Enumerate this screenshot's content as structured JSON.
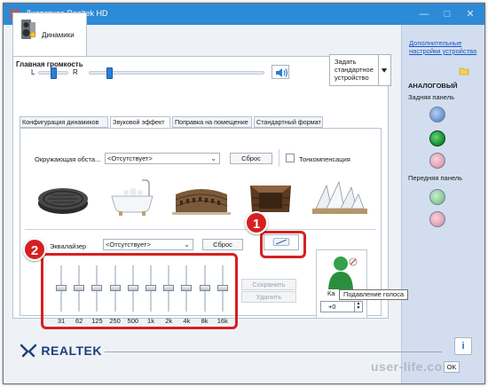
{
  "window": {
    "title": "Диспетчер Realtek HD",
    "minimize": "—",
    "maximize": "□",
    "close": "✕"
  },
  "device_tab": {
    "label": "Динамики"
  },
  "volume": {
    "title": "Главная громкость",
    "left": "L",
    "right": "R",
    "balance_level": 0.5,
    "volume_level": 0.08
  },
  "default_device_button": {
    "line1": "Задать",
    "line2": "стандартное",
    "line3": "устройство"
  },
  "tabs": [
    {
      "label": "Конфигурация динамиков"
    },
    {
      "label": "Звуковой эффект"
    },
    {
      "label": "Поправка на помещение"
    },
    {
      "label": "Стандартный формат"
    }
  ],
  "environment": {
    "label": "Окружающая обста...",
    "value": "<Отсутствует>",
    "reset": "Сброс",
    "tone_comp": "Тонкомпенсация"
  },
  "equalizer": {
    "label": "Эквалайзер",
    "value": "<Отсутствует>",
    "reset": "Сброс",
    "save": "Сохранить",
    "delete": "Удалить",
    "bands": [
      "31",
      "62",
      "125",
      "250",
      "500",
      "1k",
      "2k",
      "4k",
      "8k",
      "16k"
    ]
  },
  "voice_cancel": {
    "label_prefix": "Ка",
    "tooltip": "Подавление голоса",
    "value": "+0"
  },
  "annotations": {
    "badge1": "1",
    "badge2": "2"
  },
  "brand": {
    "name": "Realtek",
    "display": "REALTEK"
  },
  "right_panel": {
    "link": "Дополнительные настройки устройства",
    "analog": "АНАЛОГОВЫЙ",
    "rear": "Задняя панель",
    "front": "Передняя панель",
    "jack_colors": {
      "blue": "#6f9bd6",
      "green": "#1e9a3c",
      "pink": "#e6a3b6"
    }
  },
  "footer": {
    "info": "i",
    "ok": "OK",
    "watermark": "user-life.com"
  },
  "colors": {
    "titlebar": "#2d8ad6",
    "accent": "#2a7fd4",
    "annotation": "#d62020"
  }
}
